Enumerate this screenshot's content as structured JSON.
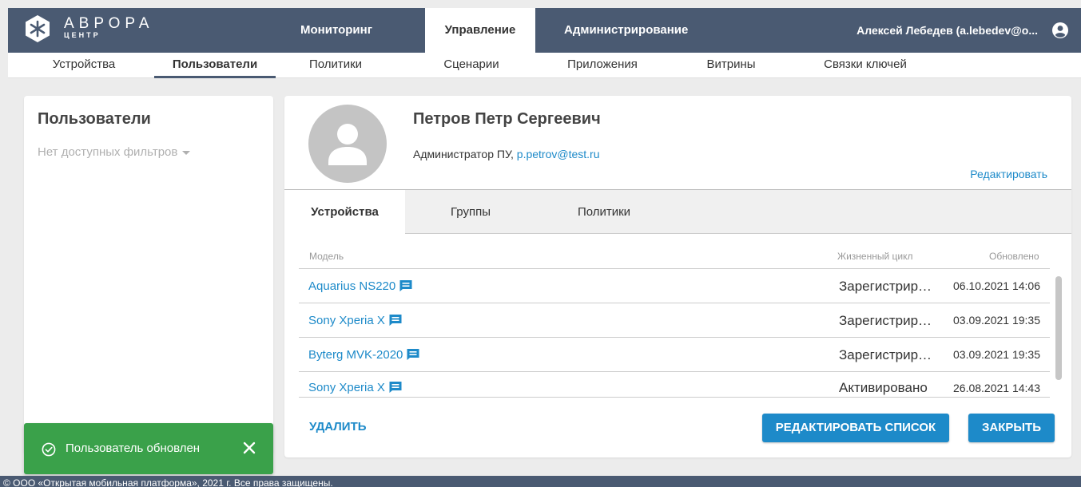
{
  "header": {
    "logo_title": "АВРОРА",
    "logo_subtitle": "ЦЕНТР",
    "tabs": [
      {
        "label": "Мониторинг"
      },
      {
        "label": "Управление"
      },
      {
        "label": "Администрирование"
      }
    ],
    "active_tab": "Управление",
    "user_name": "Алексей Лебедев (a.lebedev@o..."
  },
  "subnav": {
    "items": [
      {
        "label": "Устройства"
      },
      {
        "label": "Пользователи"
      },
      {
        "label": "Политики"
      },
      {
        "label": "Сценарии"
      },
      {
        "label": "Приложения"
      },
      {
        "label": "Витрины"
      },
      {
        "label": "Связки ключей"
      }
    ],
    "active": "Пользователи"
  },
  "left_panel": {
    "title": "Пользователи",
    "filter_label": "Нет доступных фильтров"
  },
  "profile": {
    "name": "Петров Петр Сергеевич",
    "role": "Администратор ПУ,",
    "email": "p.petrov@test.ru",
    "edit_label": "Редактировать"
  },
  "detail_tabs": {
    "items": [
      {
        "label": "Устройства"
      },
      {
        "label": "Группы"
      },
      {
        "label": "Политики"
      }
    ],
    "active": "Устройства"
  },
  "table": {
    "columns": {
      "model": "Модель",
      "lifecycle": "Жизненный цикл",
      "updated": "Обновлено"
    },
    "rows": [
      {
        "model": "Aquarius NS220",
        "lifecycle": "Зарегистрировано",
        "updated": "06.10.2021 14:06"
      },
      {
        "model": "Sony Xperia X",
        "lifecycle": "Зарегистрировано",
        "updated": "03.09.2021 19:35"
      },
      {
        "model": "Byterg MVK-2020",
        "lifecycle": "Зарегистрировано",
        "updated": "03.09.2021 19:35"
      },
      {
        "model": "Sony Xperia X",
        "lifecycle": "Активировано",
        "updated": "26.08.2021 14:43"
      }
    ]
  },
  "actions": {
    "delete_label": "УДАЛИТЬ",
    "edit_list_label": "РЕДАКТИРОВАТЬ СПИСОК",
    "close_label": "ЗАКРЫТЬ"
  },
  "toast": {
    "text": "Пользователь обновлен"
  },
  "footer": {
    "text": "© ООО «Открытая мобильная платформа», 2021 г. Все права защищены."
  },
  "colors": {
    "header_bg": "#4a5a72",
    "accent": "#1d8ac9",
    "toast_bg": "#3aa14a"
  },
  "icons": [
    "aurora-logo-icon",
    "user-circle-icon",
    "caret-down-icon",
    "avatar-placeholder-icon",
    "comment-icon",
    "check-circle-icon",
    "close-icon"
  ]
}
